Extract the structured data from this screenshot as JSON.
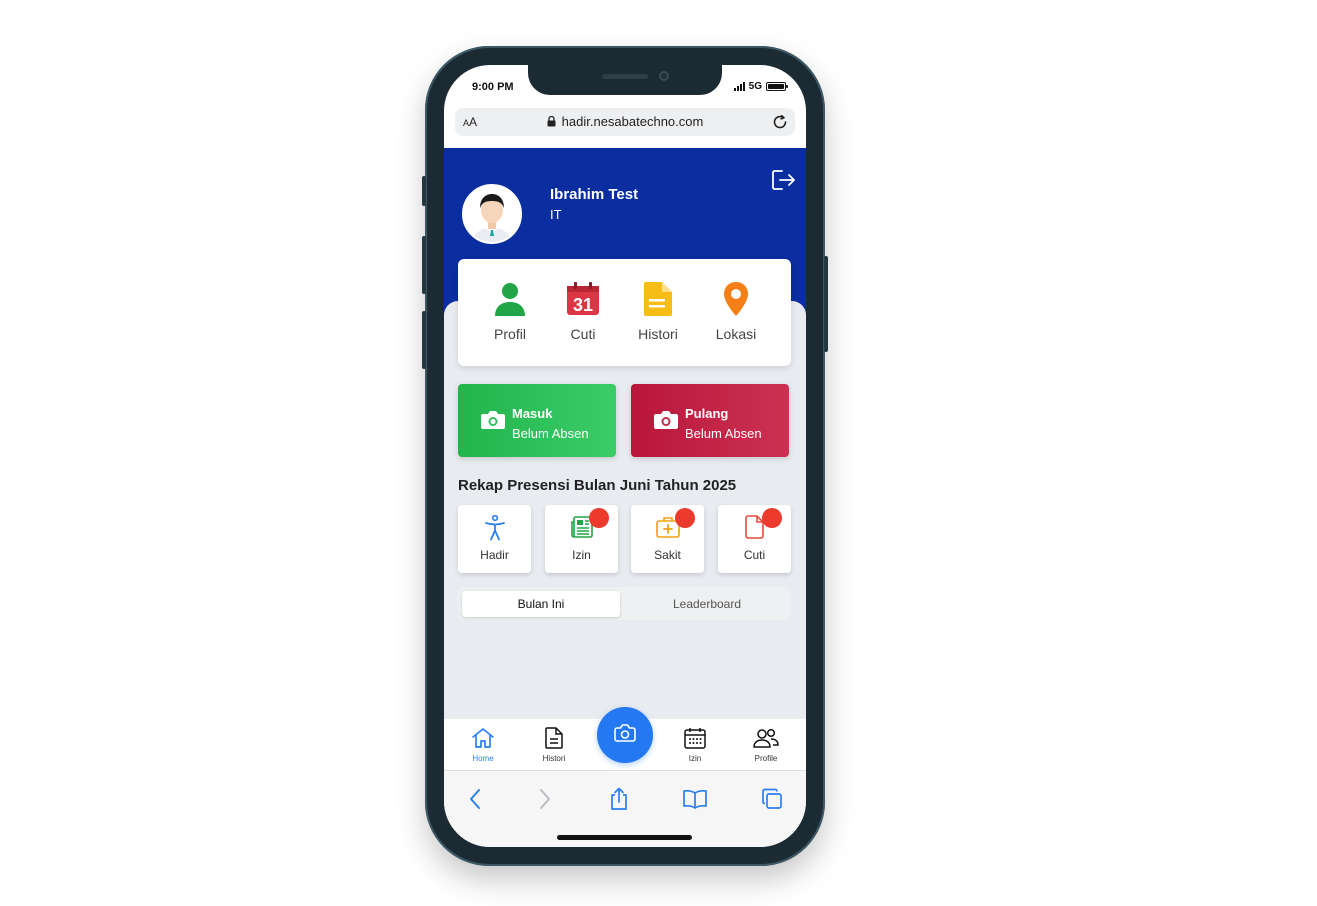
{
  "status": {
    "time": "9:00 PM",
    "network": "5G"
  },
  "browser": {
    "text_size_label_small": "A",
    "text_size_label_large": "A",
    "url": "hadir.nesabatechno.com"
  },
  "user": {
    "name": "Ibrahim Test",
    "department": "IT"
  },
  "menu": [
    {
      "label": "Profil",
      "icon": "person-icon",
      "color": "#22a546"
    },
    {
      "label": "Cuti",
      "icon": "calendar-icon",
      "color": "#dc3545",
      "day": "31"
    },
    {
      "label": "Histori",
      "icon": "document-icon",
      "color": "#f5bd16"
    },
    {
      "label": "Lokasi",
      "icon": "location-pin-icon",
      "color": "#f47f16"
    }
  ],
  "attendance": {
    "in": {
      "title": "Masuk",
      "status": "Belum Absen",
      "color": "#27b84f"
    },
    "out": {
      "title": "Pulang",
      "status": "Belum Absen",
      "color": "#c0203f"
    }
  },
  "recap": {
    "title": "Rekap Presensi Bulan Juni Tahun 2025",
    "items": [
      {
        "label": "Hadir",
        "icon": "accessibility-icon",
        "color": "#2a7ff0"
      },
      {
        "label": "Izin",
        "icon": "newspaper-icon",
        "color": "#22a546"
      },
      {
        "label": "Sakit",
        "icon": "medkit-icon",
        "color": "#f0a012"
      },
      {
        "label": "Cuti",
        "icon": "file-icon",
        "color": "#e64a3b"
      }
    ]
  },
  "tabs": {
    "active": "Bulan Ini",
    "inactive": "Leaderboard"
  },
  "bottom_nav": [
    {
      "label": "Home",
      "icon": "home-icon",
      "active": true
    },
    {
      "label": "Histori",
      "icon": "document-icon"
    },
    {
      "label": "Izin",
      "icon": "calendar-grid-icon"
    },
    {
      "label": "Profile",
      "icon": "people-icon"
    }
  ],
  "accent_color": "#2478f2",
  "header_color": "#0a2ea0"
}
